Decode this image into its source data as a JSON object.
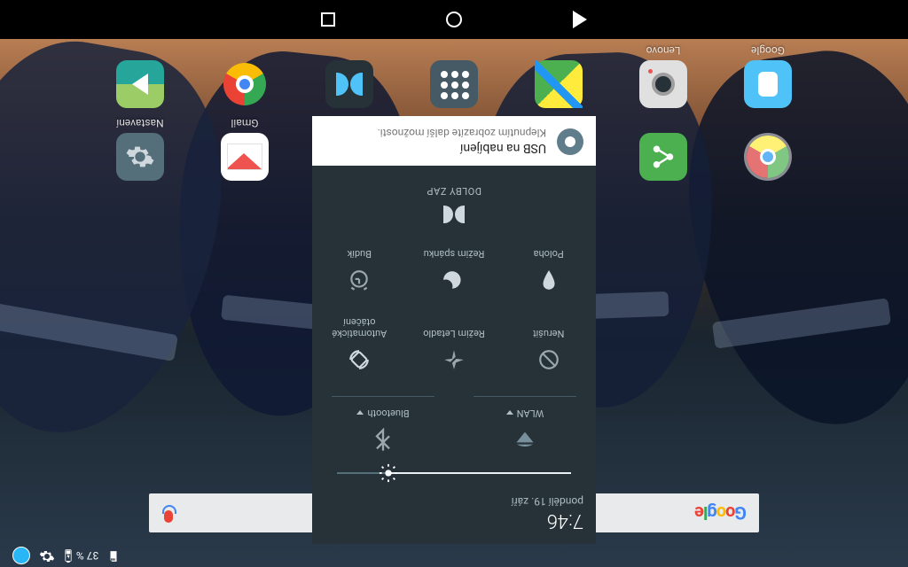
{
  "statusbar": {
    "battery_pct": "37 %"
  },
  "panel": {
    "time": "7:46",
    "date": "pondělí 19. září",
    "slider_pct": 78,
    "wlan_label": "WLAN",
    "bt_label": "Bluetooth",
    "tiles": {
      "dnd": "Nerušit",
      "airplane": "Režim Letadlo",
      "rotate": "Automatické otáčení",
      "location": "Poloha",
      "sleep": "Režim spánku",
      "alarm": "Budík"
    },
    "dolby": "DOLBY ZAP"
  },
  "notification": {
    "title": "USB na nabíjení",
    "subtitle": "Klepnutím zobrazíte další možnosti."
  },
  "apps": {
    "google": "Google",
    "lenovo": "Lenovo",
    "gmail": "Gmail",
    "settings": "Nastavení"
  },
  "search": {
    "logo": "Google"
  }
}
